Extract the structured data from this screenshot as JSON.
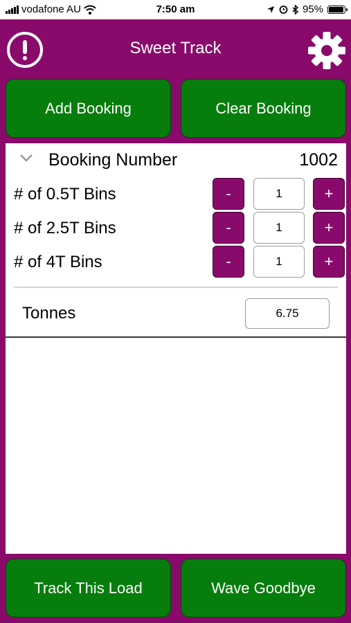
{
  "status_bar": {
    "carrier": "vodafone AU",
    "time": "7:50 am",
    "battery": "95%",
    "battery_level": 0.95
  },
  "header": {
    "title": "Sweet Track",
    "left_icon": "alert-circle-icon",
    "right_icon": "gear-icon"
  },
  "actions": {
    "add_booking": "Add Booking",
    "clear_booking": "Clear Booking"
  },
  "booking": {
    "label": "Booking Number",
    "number": "1002",
    "bins": [
      {
        "label": "# of 0.5T Bins",
        "minus": "-",
        "value": "1",
        "plus": "+"
      },
      {
        "label": "# of 2.5T Bins",
        "minus": "-",
        "value": "1",
        "plus": "+"
      },
      {
        "label": "# of 4T Bins",
        "minus": "-",
        "value": "1",
        "plus": "+"
      }
    ],
    "tonnes_label": "Tonnes",
    "tonnes_value": "6.75"
  },
  "footer": {
    "track_load": "Track This Load",
    "wave_goodbye": "Wave Goodbye"
  },
  "colors": {
    "background": "#8a0a6b",
    "button_green": "#067d0d",
    "stepper_purple": "#8a0a6b"
  }
}
